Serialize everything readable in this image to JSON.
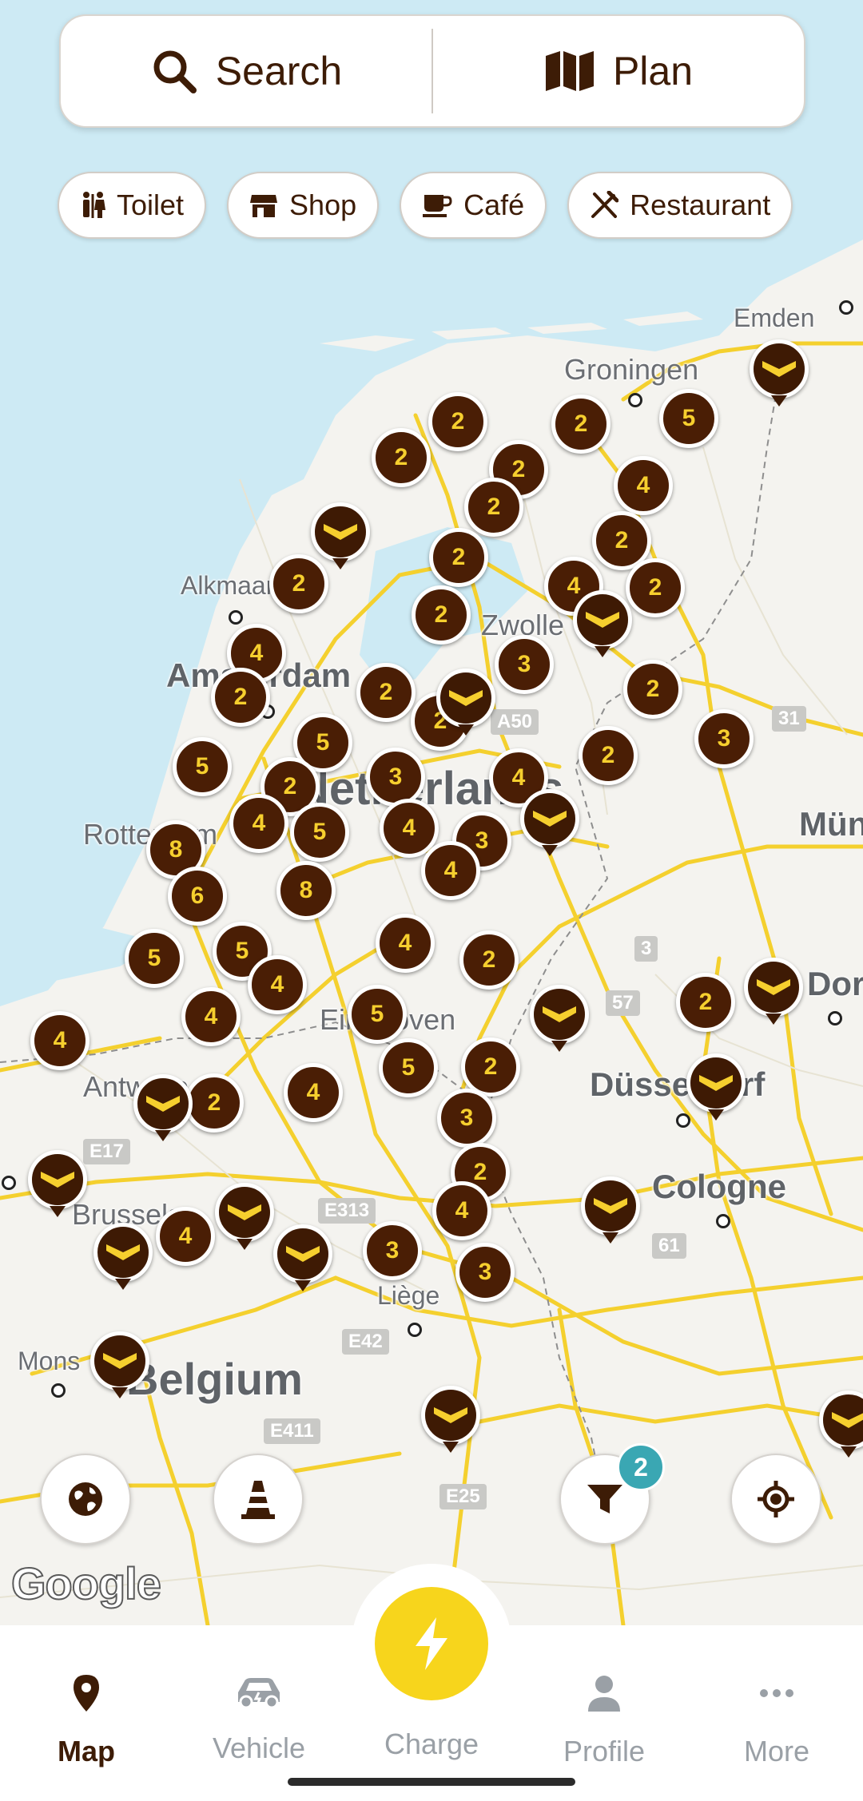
{
  "search": {
    "search_label": "Search",
    "plan_label": "Plan"
  },
  "filters": [
    {
      "label": "Toilet",
      "icon": "toilet-icon"
    },
    {
      "label": "Shop",
      "icon": "shop-icon"
    },
    {
      "label": "Café",
      "icon": "cafe-icon"
    },
    {
      "label": "Restaurant",
      "icon": "restaurant-icon"
    }
  ],
  "map": {
    "places": [
      "Emden",
      "Groningen",
      "Alkmaar",
      "Amsterdam",
      "Zwolle",
      "Netherlands",
      "Rotterdam",
      "Eindhoven",
      "Antwerp",
      "Brussels",
      "Liège",
      "Mons",
      "Belgium",
      "Düsseldorf",
      "Cologne",
      "Münster",
      "Dortmund"
    ],
    "roads": [
      "A50",
      "31",
      "3",
      "57",
      "E17",
      "E313",
      "61",
      "E42",
      "E411",
      "E25"
    ],
    "cluster_counts": [
      2,
      5,
      2,
      2,
      2,
      4,
      2,
      2,
      2,
      2,
      4,
      2,
      2,
      4,
      2,
      3,
      2,
      2,
      5,
      2,
      3,
      2,
      5,
      3,
      2,
      4,
      5,
      4,
      3,
      8,
      4,
      6,
      8,
      5,
      5,
      4,
      4,
      2,
      4,
      5,
      4,
      5,
      2,
      2,
      3,
      2,
      2,
      4,
      4,
      4,
      3,
      3
    ],
    "chargers": [
      "charger-pin"
    ]
  },
  "controls": {
    "filter_badge": "2"
  },
  "attribution": "Google",
  "nav": {
    "map": "Map",
    "vehicle": "Vehicle",
    "charge": "Charge",
    "profile": "Profile",
    "more": "More"
  },
  "colors": {
    "brand_dark": "#3e1a04",
    "accent_yellow": "#f7d51c",
    "badge_teal": "#3aa7b3",
    "water": "#cdeaf4"
  }
}
